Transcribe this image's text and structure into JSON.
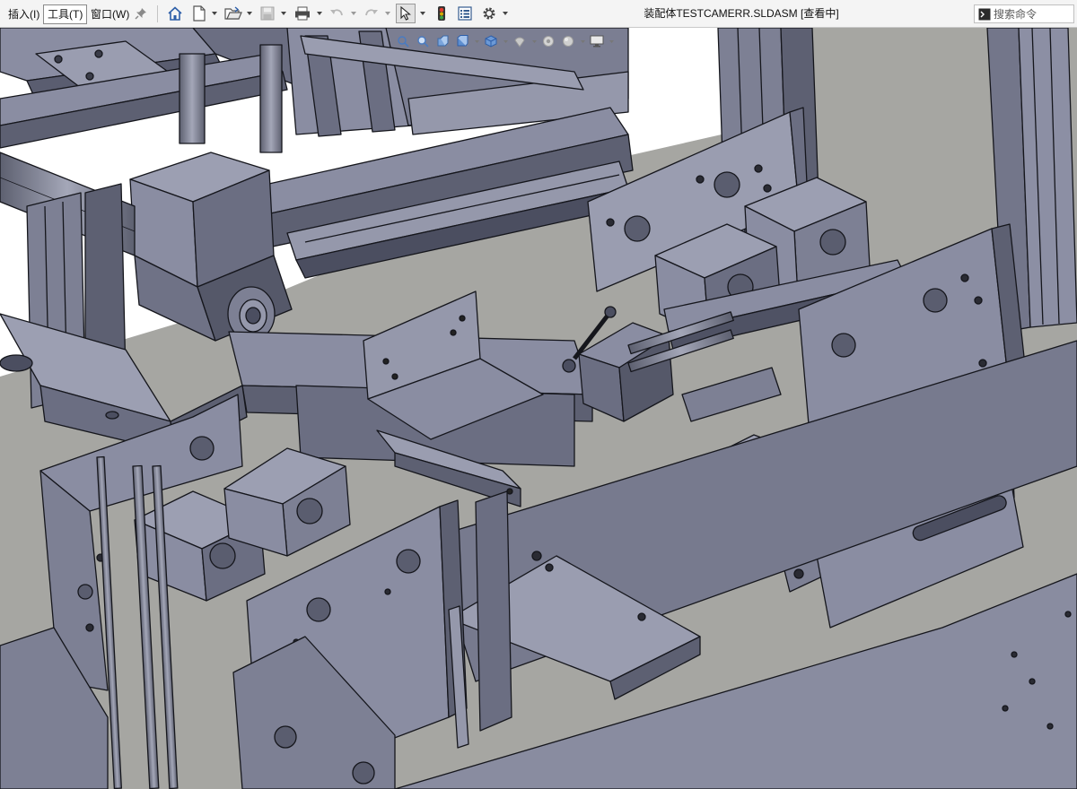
{
  "menu": [
    {
      "label": "插入(I)"
    },
    {
      "label": "工具(T)"
    },
    {
      "label": "窗口(W)"
    }
  ],
  "title": "装配体TESTCAMERR.SLDASM [查看中]",
  "search": {
    "placeholder": "搜索命令"
  },
  "toolbar_icons": [
    "pin-icon",
    "home-icon",
    "new-document-icon",
    "open-folder-icon",
    "save-icon",
    "print-icon",
    "undo-icon",
    "redo-icon",
    "select-pointer-icon",
    "traffic-light-icon",
    "file-properties-icon",
    "options-gear-icon"
  ],
  "hud_icons": [
    "zoom-to-fit-icon",
    "zoom-to-area-icon",
    "previous-view-icon",
    "section-view-icon",
    "view-orientation-icon",
    "display-style-icon",
    "hide-show-items-icon",
    "edit-appearance-icon",
    "apply-scene-icon",
    "view-settings-icon"
  ],
  "colors": {
    "part_face_light": "#8a8da2",
    "part_face_mid": "#6b6e82",
    "part_face_dark": "#4b4e60",
    "edge": "#15161c",
    "background_light": "#ffffff",
    "background_grey": "#a6a6a2",
    "toolbar_bg": "#f4f4f4"
  }
}
